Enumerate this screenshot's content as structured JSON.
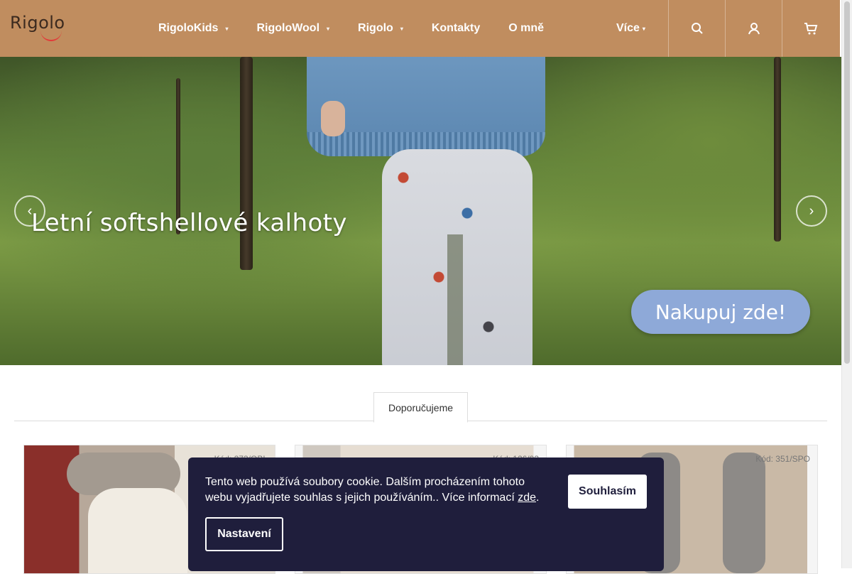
{
  "header": {
    "logo_text": "Rigolo",
    "nav": [
      {
        "label": "RigoloKids",
        "has_dropdown": true
      },
      {
        "label": "RigoloWool",
        "has_dropdown": true
      },
      {
        "label": "Rigolo",
        "has_dropdown": true
      },
      {
        "label": "Kontakty",
        "has_dropdown": false
      },
      {
        "label": "O mně",
        "has_dropdown": false
      }
    ],
    "more_label": "Více",
    "icons": [
      "search-icon",
      "user-icon",
      "cart-icon"
    ],
    "background": "#c08d5f"
  },
  "hero": {
    "title": "Letní softshellové kalhoty",
    "cta_label": "Nakupuj zde!",
    "cta_color": "#8ea9d8"
  },
  "tabs": [
    {
      "label": "Doporučujeme",
      "active": true
    }
  ],
  "products": [
    {
      "code": "Kód: 273/OBL"
    },
    {
      "code": "Kód: 126/03"
    },
    {
      "code": "Kód: 351/SPO"
    }
  ],
  "cookie": {
    "text_before": "Tento web používá soubory cookie. Dalším procházením tohoto webu vyjadřujete souhlas s jejich používáním.. Více informací ",
    "link_label": "zde",
    "text_after": ".",
    "accept_label": "Souhlasím",
    "settings_label": "Nastavení",
    "background": "#1f1e3c"
  }
}
